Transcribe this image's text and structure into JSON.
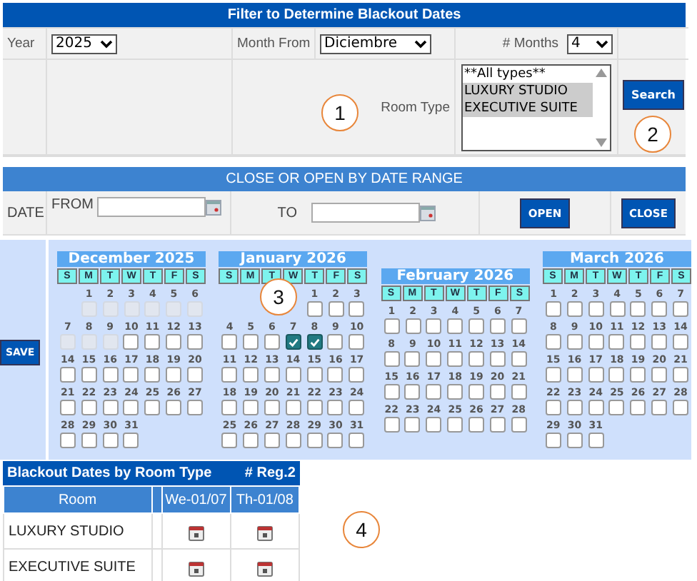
{
  "filter": {
    "title": "Filter to Determine Blackout Dates",
    "year_label": "Year",
    "year": "2025",
    "month_from_label": "Month From",
    "month_from": "Diciembre",
    "months_label": "# Months",
    "months": "4",
    "room_type_label": "Room Type",
    "room_types": [
      {
        "label": "**All types**",
        "selected": false
      },
      {
        "label": "LUXURY STUDIO",
        "selected": true
      },
      {
        "label": "EXECUTIVE SUITE",
        "selected": true
      }
    ],
    "search_button": "Search"
  },
  "range": {
    "title": "CLOSE OR OPEN BY DATE RANGE",
    "date_label": "DATE",
    "from_label": "FROM",
    "to_label": "TO",
    "open_button": "OPEN",
    "close_button": "CLOSE"
  },
  "calendar": {
    "save_button": "SAVE",
    "months": [
      {
        "title": "December 2025",
        "weekdays": [
          "S",
          "M",
          "T",
          "W",
          "T",
          "F",
          "S"
        ],
        "weeks": [
          [
            {
              "day": "1",
              "disabled": true,
              "checked": false
            },
            {
              "day": "2",
              "disabled": true,
              "checked": false
            },
            {
              "day": "3",
              "disabled": true,
              "checked": false
            },
            {
              "day": "4",
              "disabled": true,
              "checked": false
            },
            {
              "day": "5",
              "disabled": true,
              "checked": false
            },
            {
              "day": "6",
              "disabled": true,
              "checked": false
            }
          ],
          [
            {
              "day": "7",
              "disabled": true,
              "checked": false
            },
            {
              "day": "8",
              "disabled": true,
              "checked": false
            },
            {
              "day": "9",
              "disabled": true,
              "checked": false
            },
            {
              "day": "10",
              "disabled": false,
              "checked": false
            },
            {
              "day": "11",
              "disabled": false,
              "checked": false
            },
            {
              "day": "12",
              "disabled": false,
              "checked": false
            },
            {
              "day": "13",
              "disabled": false,
              "checked": false
            }
          ],
          [
            {
              "day": "14",
              "disabled": false,
              "checked": false
            },
            {
              "day": "15",
              "disabled": false,
              "checked": false
            },
            {
              "day": "16",
              "disabled": false,
              "checked": false
            },
            {
              "day": "17",
              "disabled": false,
              "checked": false
            },
            {
              "day": "18",
              "disabled": false,
              "checked": false
            },
            {
              "day": "19",
              "disabled": false,
              "checked": false
            },
            {
              "day": "20",
              "disabled": false,
              "checked": false
            }
          ],
          [
            {
              "day": "21",
              "disabled": false,
              "checked": false
            },
            {
              "day": "22",
              "disabled": false,
              "checked": false
            },
            {
              "day": "23",
              "disabled": false,
              "checked": false
            },
            {
              "day": "24",
              "disabled": false,
              "checked": false
            },
            {
              "day": "25",
              "disabled": false,
              "checked": false
            },
            {
              "day": "26",
              "disabled": false,
              "checked": false
            },
            {
              "day": "27",
              "disabled": false,
              "checked": false
            }
          ],
          [
            {
              "day": "28",
              "disabled": false,
              "checked": false
            },
            {
              "day": "29",
              "disabled": false,
              "checked": false
            },
            {
              "day": "30",
              "disabled": false,
              "checked": false
            },
            {
              "day": "31",
              "disabled": false,
              "checked": false
            }
          ]
        ]
      },
      {
        "title": "January 2026",
        "weekdays": [
          "S",
          "M",
          "T",
          "W",
          "T",
          "F",
          "S"
        ],
        "weeks": [
          [
            {
              "day": "1",
              "disabled": false,
              "checked": false
            },
            {
              "day": "2",
              "disabled": false,
              "checked": false
            },
            {
              "day": "3",
              "disabled": false,
              "checked": false
            }
          ],
          [
            {
              "day": "4",
              "disabled": false,
              "checked": false
            },
            {
              "day": "5",
              "disabled": false,
              "checked": false
            },
            {
              "day": "6",
              "disabled": false,
              "checked": false
            },
            {
              "day": "7",
              "disabled": false,
              "checked": true
            },
            {
              "day": "8",
              "disabled": false,
              "checked": true
            },
            {
              "day": "9",
              "disabled": false,
              "checked": false
            },
            {
              "day": "10",
              "disabled": false,
              "checked": false
            }
          ],
          [
            {
              "day": "11",
              "disabled": false,
              "checked": false
            },
            {
              "day": "12",
              "disabled": false,
              "checked": false
            },
            {
              "day": "13",
              "disabled": false,
              "checked": false
            },
            {
              "day": "14",
              "disabled": false,
              "checked": false
            },
            {
              "day": "15",
              "disabled": false,
              "checked": false
            },
            {
              "day": "16",
              "disabled": false,
              "checked": false
            },
            {
              "day": "17",
              "disabled": false,
              "checked": false
            }
          ],
          [
            {
              "day": "18",
              "disabled": false,
              "checked": false
            },
            {
              "day": "19",
              "disabled": false,
              "checked": false
            },
            {
              "day": "20",
              "disabled": false,
              "checked": false
            },
            {
              "day": "21",
              "disabled": false,
              "checked": false
            },
            {
              "day": "22",
              "disabled": false,
              "checked": false
            },
            {
              "day": "23",
              "disabled": false,
              "checked": false
            },
            {
              "day": "24",
              "disabled": false,
              "checked": false
            }
          ],
          [
            {
              "day": "25",
              "disabled": false,
              "checked": false
            },
            {
              "day": "26",
              "disabled": false,
              "checked": false
            },
            {
              "day": "27",
              "disabled": false,
              "checked": false
            },
            {
              "day": "28",
              "disabled": false,
              "checked": false
            },
            {
              "day": "29",
              "disabled": false,
              "checked": false
            },
            {
              "day": "30",
              "disabled": false,
              "checked": false
            },
            {
              "day": "31",
              "disabled": false,
              "checked": false
            }
          ]
        ]
      },
      {
        "title": "February 2026",
        "weekdays": [
          "S",
          "M",
          "T",
          "W",
          "T",
          "F",
          "S"
        ],
        "weeks": [
          [
            {
              "day": "1",
              "disabled": false,
              "checked": false
            },
            {
              "day": "2",
              "disabled": false,
              "checked": false
            },
            {
              "day": "3",
              "disabled": false,
              "checked": false
            },
            {
              "day": "4",
              "disabled": false,
              "checked": false
            },
            {
              "day": "5",
              "disabled": false,
              "checked": false
            },
            {
              "day": "6",
              "disabled": false,
              "checked": false
            },
            {
              "day": "7",
              "disabled": false,
              "checked": false
            }
          ],
          [
            {
              "day": "8",
              "disabled": false,
              "checked": false
            },
            {
              "day": "9",
              "disabled": false,
              "checked": false
            },
            {
              "day": "10",
              "disabled": false,
              "checked": false
            },
            {
              "day": "11",
              "disabled": false,
              "checked": false
            },
            {
              "day": "12",
              "disabled": false,
              "checked": false
            },
            {
              "day": "13",
              "disabled": false,
              "checked": false
            },
            {
              "day": "14",
              "disabled": false,
              "checked": false
            }
          ],
          [
            {
              "day": "15",
              "disabled": false,
              "checked": false
            },
            {
              "day": "16",
              "disabled": false,
              "checked": false
            },
            {
              "day": "17",
              "disabled": false,
              "checked": false
            },
            {
              "day": "18",
              "disabled": false,
              "checked": false
            },
            {
              "day": "19",
              "disabled": false,
              "checked": false
            },
            {
              "day": "20",
              "disabled": false,
              "checked": false
            },
            {
              "day": "21",
              "disabled": false,
              "checked": false
            }
          ],
          [
            {
              "day": "22",
              "disabled": false,
              "checked": false
            },
            {
              "day": "23",
              "disabled": false,
              "checked": false
            },
            {
              "day": "24",
              "disabled": false,
              "checked": false
            },
            {
              "day": "25",
              "disabled": false,
              "checked": false
            },
            {
              "day": "26",
              "disabled": false,
              "checked": false
            },
            {
              "day": "27",
              "disabled": false,
              "checked": false
            },
            {
              "day": "28",
              "disabled": false,
              "checked": false
            }
          ]
        ]
      },
      {
        "title": "March 2026",
        "weekdays": [
          "S",
          "M",
          "T",
          "W",
          "T",
          "F",
          "S"
        ],
        "weeks": [
          [
            {
              "day": "1",
              "disabled": false,
              "checked": false
            },
            {
              "day": "2",
              "disabled": false,
              "checked": false
            },
            {
              "day": "3",
              "disabled": false,
              "checked": false
            },
            {
              "day": "4",
              "disabled": false,
              "checked": false
            },
            {
              "day": "5",
              "disabled": false,
              "checked": false
            },
            {
              "day": "6",
              "disabled": false,
              "checked": false
            },
            {
              "day": "7",
              "disabled": false,
              "checked": false
            }
          ],
          [
            {
              "day": "8",
              "disabled": false,
              "checked": false
            },
            {
              "day": "9",
              "disabled": false,
              "checked": false
            },
            {
              "day": "10",
              "disabled": false,
              "checked": false
            },
            {
              "day": "11",
              "disabled": false,
              "checked": false
            },
            {
              "day": "12",
              "disabled": false,
              "checked": false
            },
            {
              "day": "13",
              "disabled": false,
              "checked": false
            },
            {
              "day": "14",
              "disabled": false,
              "checked": false
            }
          ],
          [
            {
              "day": "15",
              "disabled": false,
              "checked": false
            },
            {
              "day": "16",
              "disabled": false,
              "checked": false
            },
            {
              "day": "17",
              "disabled": false,
              "checked": false
            },
            {
              "day": "18",
              "disabled": false,
              "checked": false
            },
            {
              "day": "19",
              "disabled": false,
              "checked": false
            },
            {
              "day": "20",
              "disabled": false,
              "checked": false
            },
            {
              "day": "21",
              "disabled": false,
              "checked": false
            }
          ],
          [
            {
              "day": "22",
              "disabled": false,
              "checked": false
            },
            {
              "day": "23",
              "disabled": false,
              "checked": false
            },
            {
              "day": "24",
              "disabled": false,
              "checked": false
            },
            {
              "day": "25",
              "disabled": false,
              "checked": false
            },
            {
              "day": "26",
              "disabled": false,
              "checked": false
            },
            {
              "day": "27",
              "disabled": false,
              "checked": false
            },
            {
              "day": "28",
              "disabled": false,
              "checked": false
            }
          ],
          [
            {
              "day": "29",
              "disabled": false,
              "checked": false
            },
            {
              "day": "30",
              "disabled": false,
              "checked": false
            },
            {
              "day": "31",
              "disabled": false,
              "checked": false
            }
          ]
        ]
      }
    ]
  },
  "blackout": {
    "title": "Blackout Dates by Room Type",
    "count": "# Reg.2",
    "columns": [
      "Room",
      "We-01/07",
      "Th-01/08"
    ],
    "rows": [
      {
        "room": "LUXURY STUDIO",
        "marks": [
          {
            "kind": "blocked"
          },
          {
            "kind": "blocked"
          }
        ]
      },
      {
        "room": "EXECUTIVE SUITE",
        "marks": [
          {
            "kind": "blocked"
          },
          {
            "kind": "blocked"
          }
        ]
      }
    ]
  },
  "callouts": [
    "1",
    "2",
    "3",
    "4"
  ]
}
